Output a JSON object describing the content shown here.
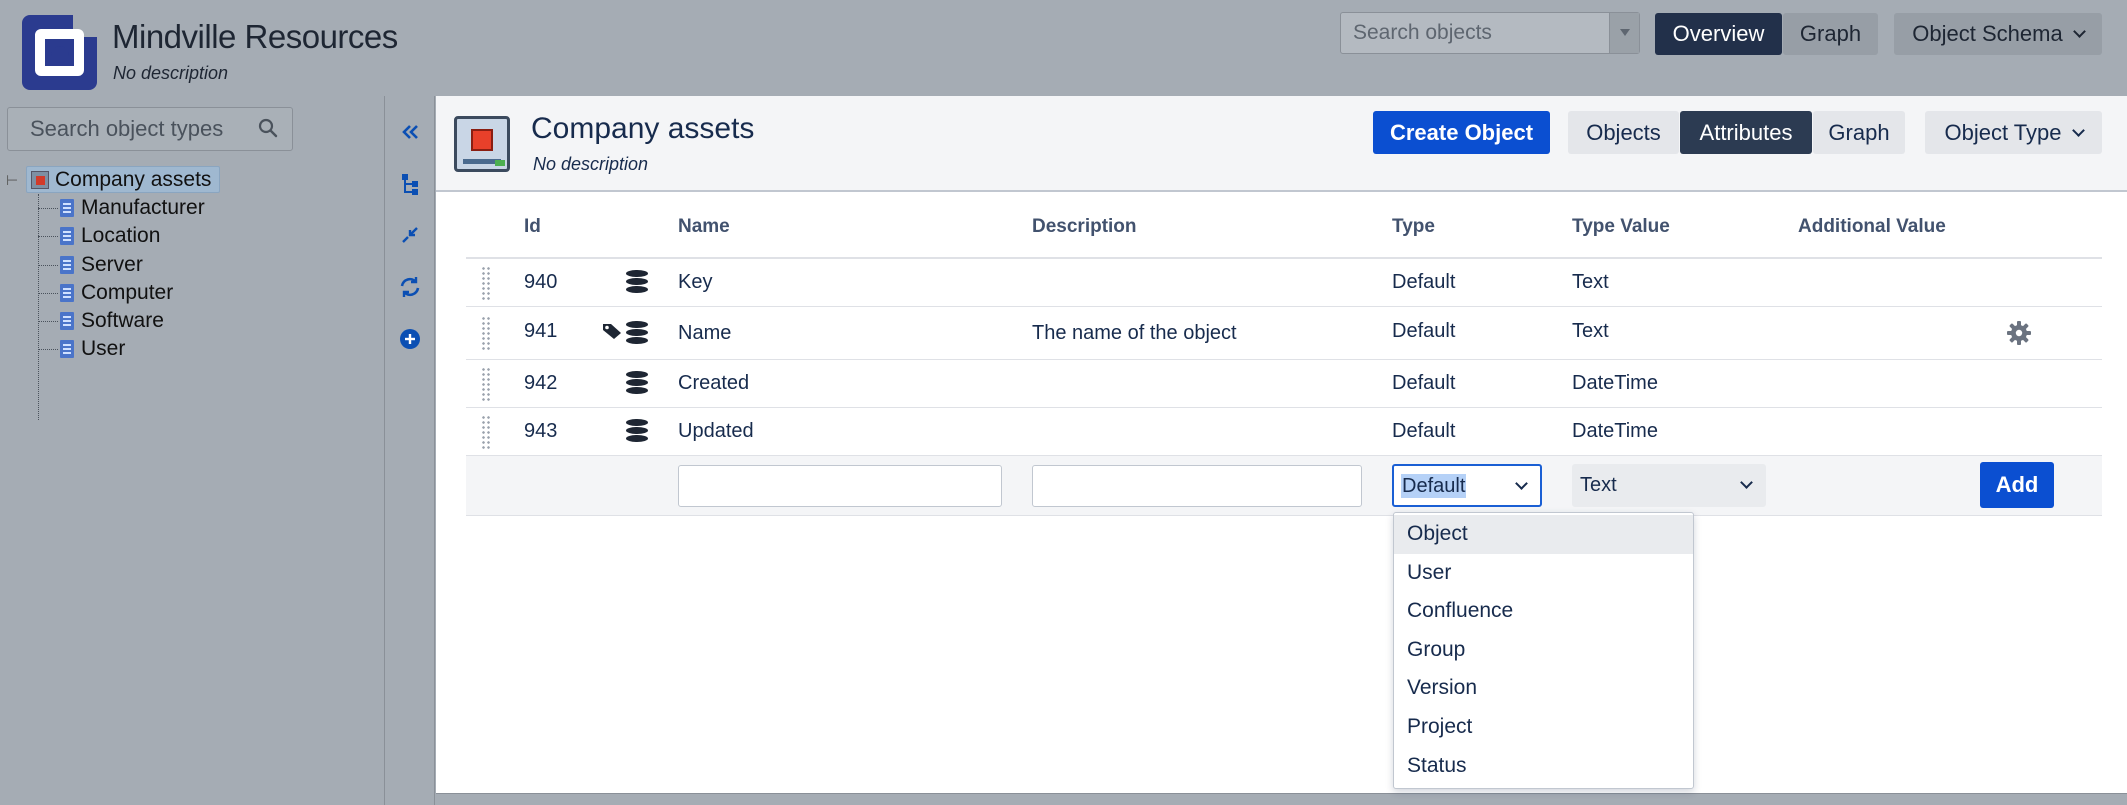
{
  "app": {
    "title": "Mindville Resources",
    "description": "No description",
    "search_placeholder": "Search objects",
    "nav": {
      "overview": "Overview",
      "graph": "Graph",
      "schema": "Object Schema"
    }
  },
  "sidebar": {
    "search_placeholder": "Search object types",
    "tree": {
      "root": "Company assets",
      "children": [
        "Manufacturer",
        "Location",
        "Server",
        "Computer",
        "Software",
        "User"
      ]
    }
  },
  "object_type": {
    "title": "Company assets",
    "description": "No description",
    "buttons": {
      "create": "Create Object",
      "objects": "Objects",
      "attributes": "Attributes",
      "graph": "Graph",
      "object_type": "Object Type"
    }
  },
  "table": {
    "columns": [
      "Id",
      "Name",
      "Description",
      "Type",
      "Type Value",
      "Additional Value"
    ],
    "rows": [
      {
        "id": "940",
        "name": "Key",
        "description": "",
        "type": "Default",
        "type_value": "Text",
        "label_tag": false,
        "config": false
      },
      {
        "id": "941",
        "name": "Name",
        "description": "The name of the object",
        "type": "Default",
        "type_value": "Text",
        "label_tag": true,
        "config": true
      },
      {
        "id": "942",
        "name": "Created",
        "description": "",
        "type": "Default",
        "type_value": "DateTime",
        "label_tag": false,
        "config": false
      },
      {
        "id": "943",
        "name": "Updated",
        "description": "",
        "type": "Default",
        "type_value": "DateTime",
        "label_tag": false,
        "config": false
      }
    ],
    "new_row": {
      "name_value": "",
      "description_value": "",
      "type_selected": "Default",
      "type_value_selected": "Text",
      "add_label": "Add"
    }
  },
  "type_dropdown": {
    "options": [
      "Object",
      "User",
      "Confluence",
      "Group",
      "Version",
      "Project",
      "Status"
    ],
    "highlighted": "Object"
  },
  "colors": {
    "primary": "#0b4fd1",
    "header_dark": "#22304a",
    "overlay_gray": "#a5acb4"
  }
}
